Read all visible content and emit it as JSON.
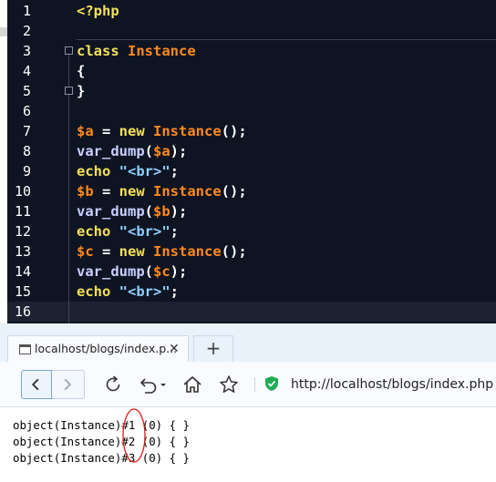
{
  "editor": {
    "line_numbers": [
      "1",
      "2",
      "3",
      "4",
      "5",
      "6",
      "7",
      "8",
      "9",
      "10",
      "11",
      "12",
      "13",
      "14",
      "15",
      "16"
    ],
    "code": {
      "l1": {
        "open": "<?php"
      },
      "l3": {
        "kw": "class",
        "name": "Instance"
      },
      "l4": {
        "brace": "{"
      },
      "l5": {
        "brace": "}"
      },
      "l7": {
        "var": "$a",
        "op": " = ",
        "kw": "new",
        "cls": "Instance",
        "tail": "();"
      },
      "l8": {
        "fn": "var_dump",
        "open": "(",
        "var": "$a",
        "close": ");"
      },
      "l9": {
        "kw": "echo",
        "str": "\"<br>\"",
        "tail": ";"
      },
      "l10": {
        "var": "$b",
        "op": " = ",
        "kw": "new",
        "cls": "Instance",
        "tail": "();"
      },
      "l11": {
        "fn": "var_dump",
        "open": "(",
        "var": "$b",
        "close": ");"
      },
      "l12": {
        "kw": "echo",
        "str": "\"<br>\"",
        "tail": ";"
      },
      "l13": {
        "var": "$c",
        "op": " = ",
        "kw": "new",
        "cls": "Instance",
        "tail": "();"
      },
      "l14": {
        "fn": "var_dump",
        "open": "(",
        "var": "$c",
        "close": ");"
      },
      "l15": {
        "kw": "echo",
        "str": "\"<br>\"",
        "tail": ";"
      }
    },
    "colors": {
      "background": "#0f1423",
      "keyword": "#f3e05a",
      "class": "#ff8a1c",
      "function": "#c8d0ff",
      "string": "#8ed1ff"
    }
  },
  "browser": {
    "tab": {
      "title": "localhost/blogs/index.p...",
      "close": "✕",
      "favicon": "page-icon"
    },
    "new_tab": "+",
    "toolbar": {
      "icons": [
        "back-icon",
        "forward-icon",
        "refresh-icon",
        "undo-icon",
        "home-icon",
        "star-icon",
        "shield-icon"
      ],
      "url": "http://localhost/blogs/index.php"
    },
    "output": [
      "object(Instance)#1 (0) { }",
      "object(Instance)#2 (0) { }",
      "object(Instance)#3 (0) { }"
    ],
    "highlight_color": "#e01818"
  }
}
